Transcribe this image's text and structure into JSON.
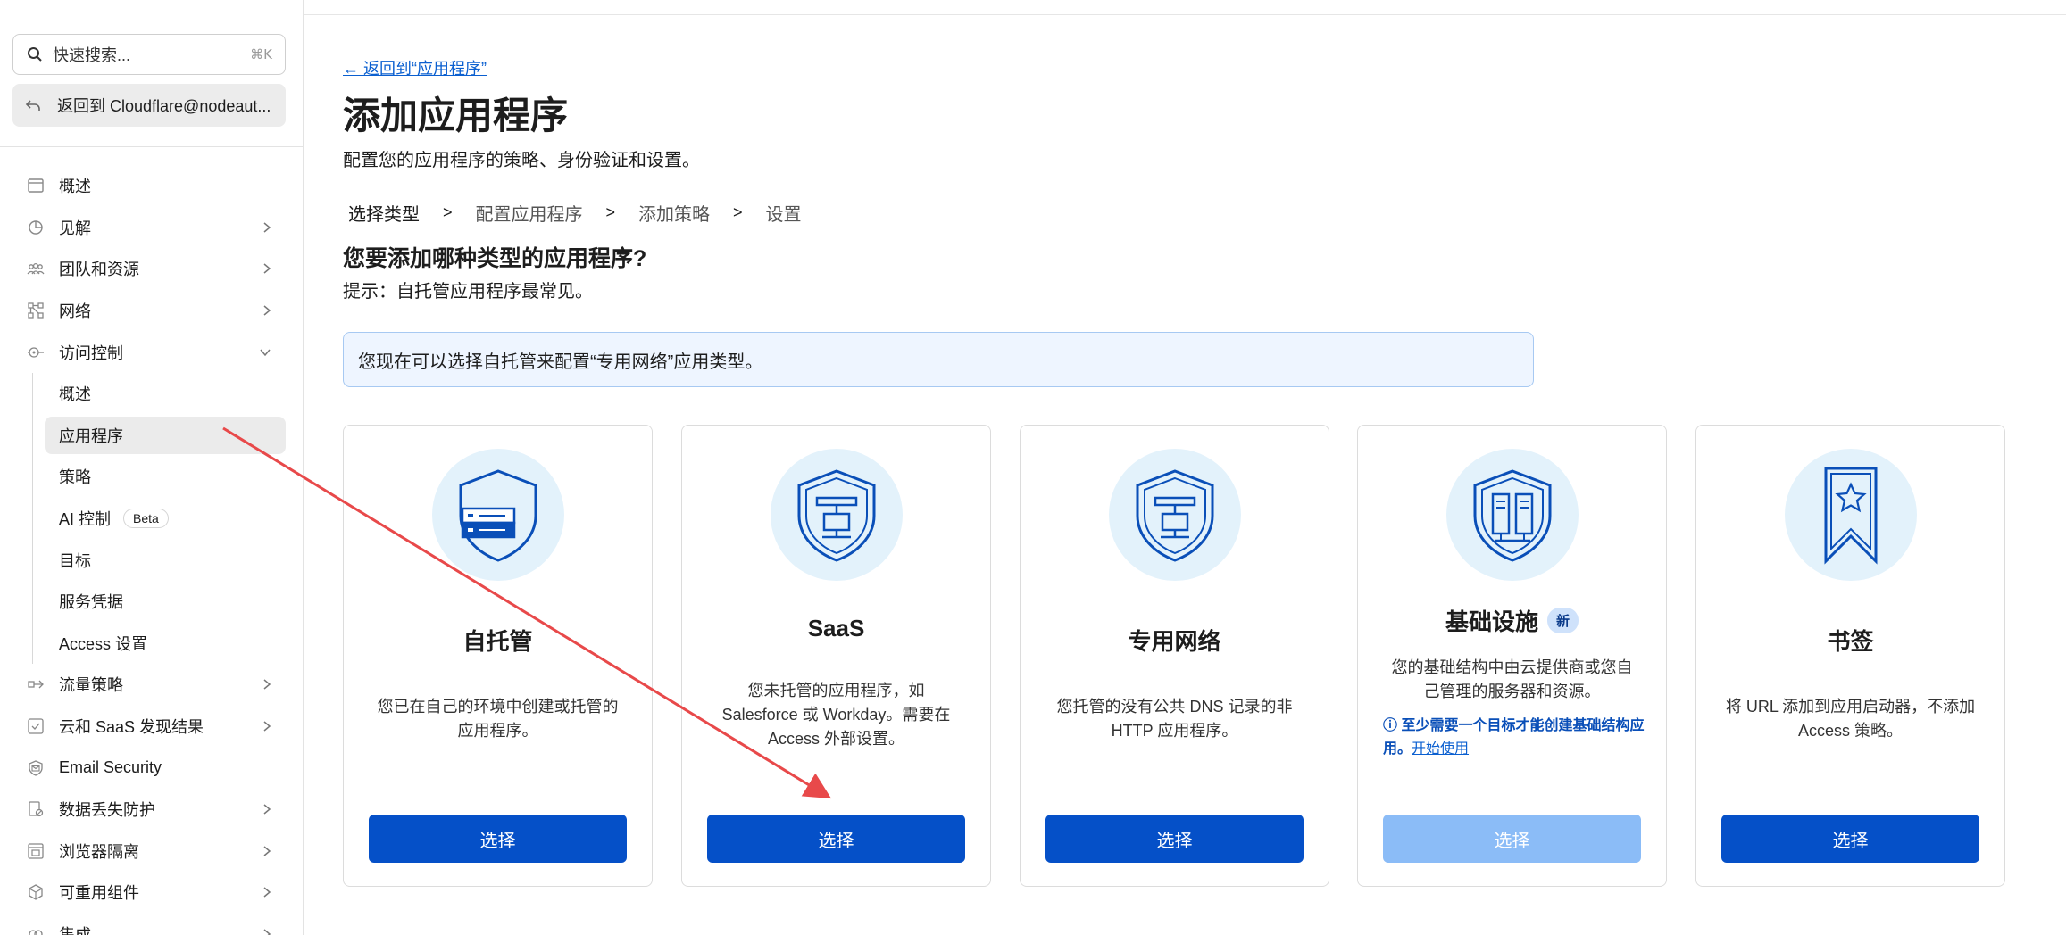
{
  "sidebar": {
    "search_placeholder": "快速搜索...",
    "search_shortcut": "⌘K",
    "back_account": "返回到 Cloudflare@nodeaut...",
    "items": [
      {
        "label": "概述",
        "icon": "browser-window-icon",
        "chevron": false
      },
      {
        "label": "见解",
        "icon": "pie-chart-icon",
        "chevron": true
      },
      {
        "label": "团队和资源",
        "icon": "people-icon",
        "chevron": true
      },
      {
        "label": "网络",
        "icon": "network-icon",
        "chevron": true
      },
      {
        "label": "访问控制",
        "icon": "access-icon",
        "chevron": "down"
      }
    ],
    "access_sub": [
      "概述",
      "应用程序",
      "策略",
      "AI 控制",
      "目标",
      "服务凭据",
      "Access 设置"
    ],
    "beta_label": "Beta",
    "items_after": [
      {
        "label": "流量策略",
        "icon": "traffic-icon",
        "chevron": true
      },
      {
        "label": "云和 SaaS 发现结果",
        "icon": "cloud-check-icon",
        "chevron": true
      },
      {
        "label": "Email Security",
        "icon": "email-shield-icon",
        "chevron": false
      },
      {
        "label": "数据丢失防护",
        "icon": "data-loss-icon",
        "chevron": true
      },
      {
        "label": "浏览器隔离",
        "icon": "browser-isolation-icon",
        "chevron": true
      },
      {
        "label": "可重用组件",
        "icon": "components-icon",
        "chevron": true
      },
      {
        "label": "集成",
        "icon": "integration-icon",
        "chevron": true
      }
    ]
  },
  "main": {
    "back_link": "← 返回到“应用程序”",
    "title": "添加应用程序",
    "subtitle": "配置您的应用程序的策略、身份验证和设置。",
    "steps": [
      "选择类型",
      "配置应用程序",
      "添加策略",
      "设置"
    ],
    "step_sep": ">",
    "question": "您要添加哪种类型的应用程序?",
    "hint": "提示：自托管应用程序最常见。",
    "banner": "您现在可以选择自托管来配置“专用网络”应用类型。",
    "cards": [
      {
        "name": "自托管",
        "desc": "您已在自己的环境中创建或托管的应用程序。",
        "button": "选择",
        "icon": "self-hosted-shield-icon"
      },
      {
        "name": "SaaS",
        "desc": "您未托管的应用程序，如 Salesforce 或 Workday。需要在 Access 外部设置。",
        "button": "选择",
        "icon": "saas-shield-icon"
      },
      {
        "name": "专用网络",
        "desc": "您托管的没有公共 DNS 记录的非 HTTP 应用程序。",
        "button": "选择",
        "icon": "private-network-shield-icon"
      },
      {
        "name": "基础设施",
        "badge": "新",
        "desc": "您的基础结构中由云提供商或您自己管理的服务器和资源。",
        "note": "至少需要一个目标才能创建基础结构应用。",
        "note_link": "开始使用",
        "button": "选择",
        "disabled": true,
        "icon": "infrastructure-shield-icon"
      },
      {
        "name": "书签",
        "desc": "将 URL 添加到应用启动器，不添加 Access 策略。",
        "button": "选择",
        "icon": "bookmark-icon"
      }
    ]
  },
  "colors": {
    "primary": "#0550c8",
    "disabled": "#8bbcf7",
    "icon_blue": "#0a4fb8",
    "circle_bg": "#e3f2fb",
    "arrow": "#e8494a"
  }
}
